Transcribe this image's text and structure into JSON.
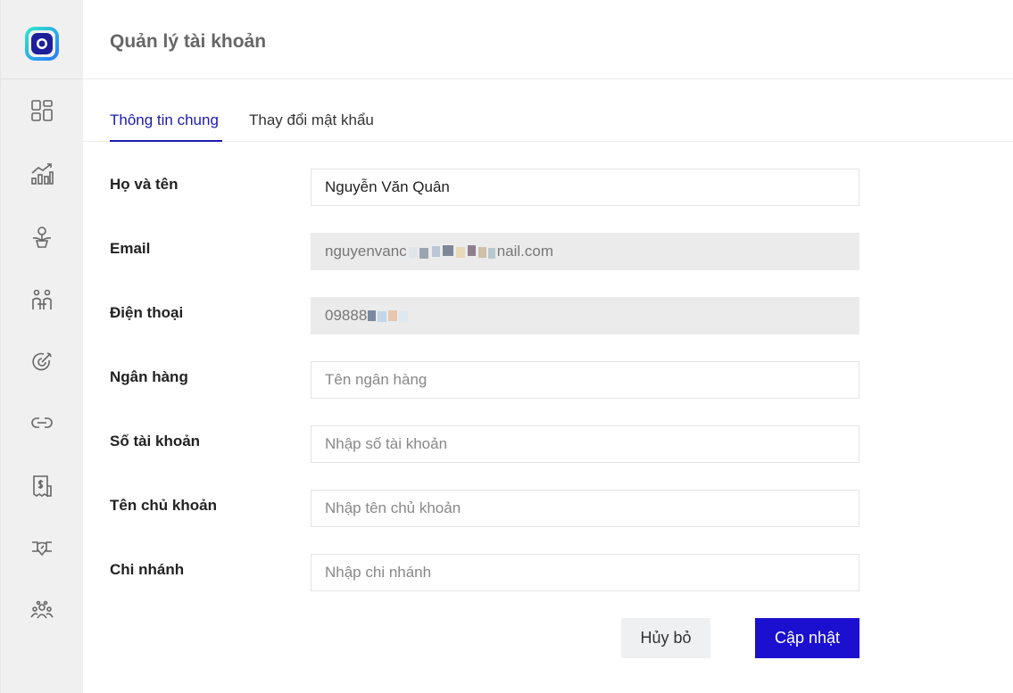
{
  "header": {
    "title": "Quản lý tài khoản"
  },
  "sidebar": {
    "logo": "app-logo",
    "items": [
      {
        "icon": "dashboard-icon"
      },
      {
        "icon": "chart-growth-icon"
      },
      {
        "icon": "idea-plant-icon"
      },
      {
        "icon": "people-icon"
      },
      {
        "icon": "target-icon"
      },
      {
        "icon": "link-icon"
      },
      {
        "icon": "invoice-dollar-icon"
      },
      {
        "icon": "handshake-icon"
      },
      {
        "icon": "team-icon"
      }
    ]
  },
  "tabs": [
    {
      "label": "Thông tin chung",
      "active": true
    },
    {
      "label": "Thay đổi mật khẩu",
      "active": false
    }
  ],
  "form": {
    "fields": [
      {
        "label": "Họ và tên",
        "value": "Nguyễn Văn Quân",
        "placeholder": "",
        "disabled": false
      },
      {
        "label": "Email",
        "value": "nguyenvanc",
        "value_suffix": "nail.com",
        "placeholder": "",
        "disabled": true
      },
      {
        "label": "Điện thoại",
        "value": "09888",
        "placeholder": "",
        "disabled": true
      },
      {
        "label": "Ngân hàng",
        "value": "",
        "placeholder": "Tên ngân hàng",
        "disabled": false
      },
      {
        "label": "Số tài khoản",
        "value": "",
        "placeholder": "Nhập số tài khoản",
        "disabled": false
      },
      {
        "label": "Tên chủ khoản",
        "value": "",
        "placeholder": "Nhập tên chủ khoản",
        "disabled": false
      },
      {
        "label": "Chi nhánh",
        "value": "",
        "placeholder": "Nhập chi nhánh",
        "disabled": false
      }
    ],
    "cancel_label": "Hủy bỏ",
    "submit_label": "Cập nhật"
  },
  "colors": {
    "accent": "#1b1bb0",
    "primary_button": "#1b0fd0",
    "sidebar_bg": "#f0f0f0",
    "disabled_input_bg": "#ebebeb"
  }
}
